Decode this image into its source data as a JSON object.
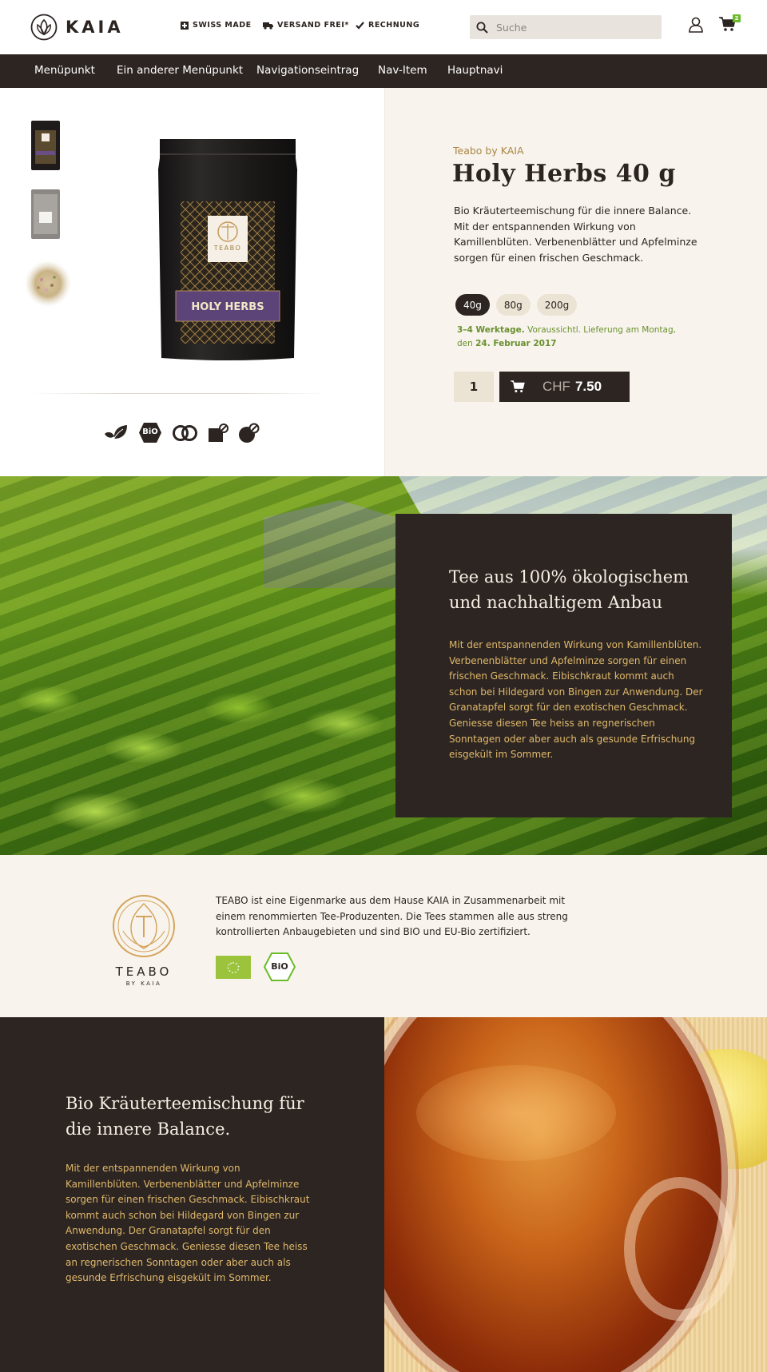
{
  "header": {
    "logo_text": "KAIA",
    "usps": [
      {
        "label": "SWISS MADE",
        "icon": "swiss-cross-icon"
      },
      {
        "label": "VERSAND FREI*",
        "icon": "truck-icon"
      },
      {
        "label": "RECHNUNG",
        "icon": "checkmark-icon"
      }
    ],
    "search_placeholder": "Suche",
    "cart_count": "2"
  },
  "nav": {
    "items": [
      "Menüpunkt",
      "Ein anderer Menüpunkt",
      "Navigationseintrag",
      "Nav-Item",
      "Hauptnavi"
    ]
  },
  "product": {
    "brand": "Teabo by KAIA",
    "title": "Holy Herbs 40 g",
    "description": "Bio Kräuterteemischung für die innere Balance. Mit der entspannenden Wirkung von Kamillenblüten. Verbenenblätter und Apfelminze sorgen für einen frischen Geschmack.",
    "package_label": "HOLY HERBS",
    "package_brand": "TEABO",
    "sizes": [
      "40g",
      "80g",
      "200g"
    ],
    "selected_size": "40g",
    "delivery": {
      "days": "3–4 Werktage.",
      "text": " Voraussichtl. Lieferung am Montag, den ",
      "date": "24. Februar 2017"
    },
    "quantity": "1",
    "currency": "CHF",
    "price": "7.50",
    "badge_icons": [
      "leaf-icon",
      "bio-hexagon-icon",
      "rings-icon",
      "box-icon",
      "sphere-icon"
    ],
    "badge_bio_text": "BiO"
  },
  "plantation": {
    "heading": "Tee aus 100% ökologischem und nachhaltigem Anbau",
    "text": "Mit der entspannenden Wirkung von Kamillenblüten. Verbenenblätter und Apfelminze sorgen für einen frischen Geschmack. Eibischkraut kommt auch schon bei Hildegard von Bingen zur Anwendung. Der Granatapfel sorgt für den exotischen Geschmack. Geniesse diesen Tee heiss an regnerischen Sonntagen oder aber auch als gesunde Erfrischung eisgekült im Sommer."
  },
  "teabo": {
    "logo_name": "TEABO",
    "logo_sub": "BY KAIA",
    "text": "TEABO ist eine Eigenmarke aus dem Hause KAIA in Zusammenarbeit mit einem renommierten Tee-Produzenten. Die Tees stammen alle aus streng kontrollierten Anbaugebieten und sind BIO und EU-Bio zertifiziert.",
    "bio_text": "BiO"
  },
  "bottom": {
    "heading": "Bio Kräuterteemischung für die innere Balance.",
    "text": "Mit der entspannenden Wirkung von Kamillenblüten. Verbenenblätter und Apfelminze sorgen für einen frischen Geschmack. Eibischkraut kommt auch schon bei Hildegard von Bingen zur Anwendung. Der Granatapfel sorgt für den exotischen Geschmack. Geniesse diesen Tee heiss an regnerischen Sonntagen oder aber auch als gesunde Erfrischung eisgekült im Sommer."
  },
  "colors": {
    "dark": "#2d2522",
    "cream": "#f8f4ed",
    "gold": "#e0b96b",
    "brand_gold": "#a98542",
    "green": "#6a8f2e",
    "accent_green": "#6cbb2a"
  }
}
